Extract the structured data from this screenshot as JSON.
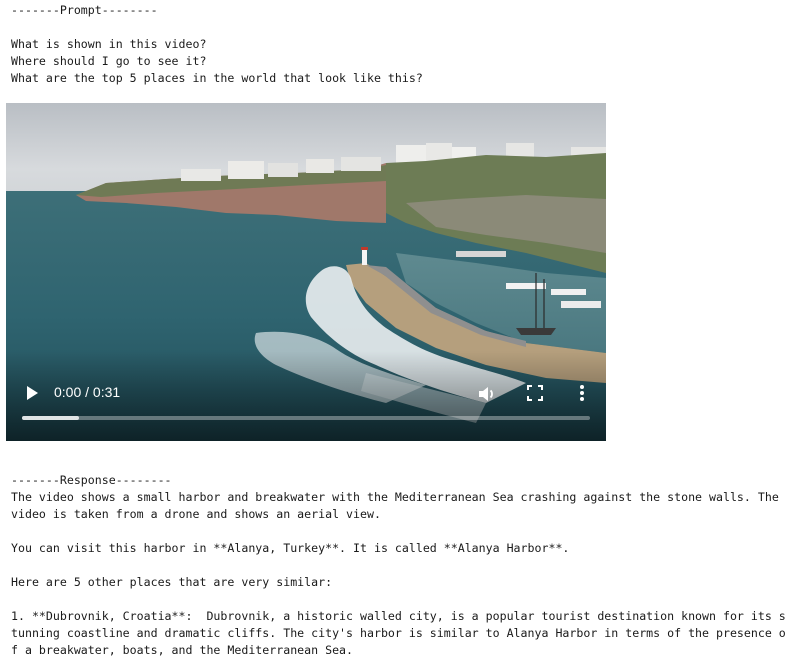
{
  "prompt": {
    "header": "-------Prompt--------",
    "lines": [
      "What is shown in this video?",
      "Where should I go to see it?",
      "What are the top 5 places in the world that look like this?"
    ]
  },
  "video": {
    "time_label": "0:00 / 0:31",
    "progress_fraction": 0.1,
    "icons": {
      "play": "play-icon",
      "volume": "volume-icon",
      "fullscreen": "fullscreen-icon",
      "more": "more-vertical-icon"
    }
  },
  "response": {
    "header": "-------Response--------",
    "paragraph1": "The video shows a small harbor and breakwater with the Mediterranean Sea crashing against the stone walls. The video is taken from a drone and shows an aerial view.",
    "paragraph2": "You can visit this harbor in **Alanya, Turkey**. It is called **Alanya Harbor**.",
    "paragraph3": "Here are 5 other places that are very similar:",
    "item1": "1. **Dubrovnik, Croatia**:  Dubrovnik, a historic walled city, is a popular tourist destination known for its stunning coastline and dramatic cliffs. The city's harbor is similar to Alanya Harbor in terms of the presence of a breakwater, boats, and the Mediterranean Sea."
  }
}
